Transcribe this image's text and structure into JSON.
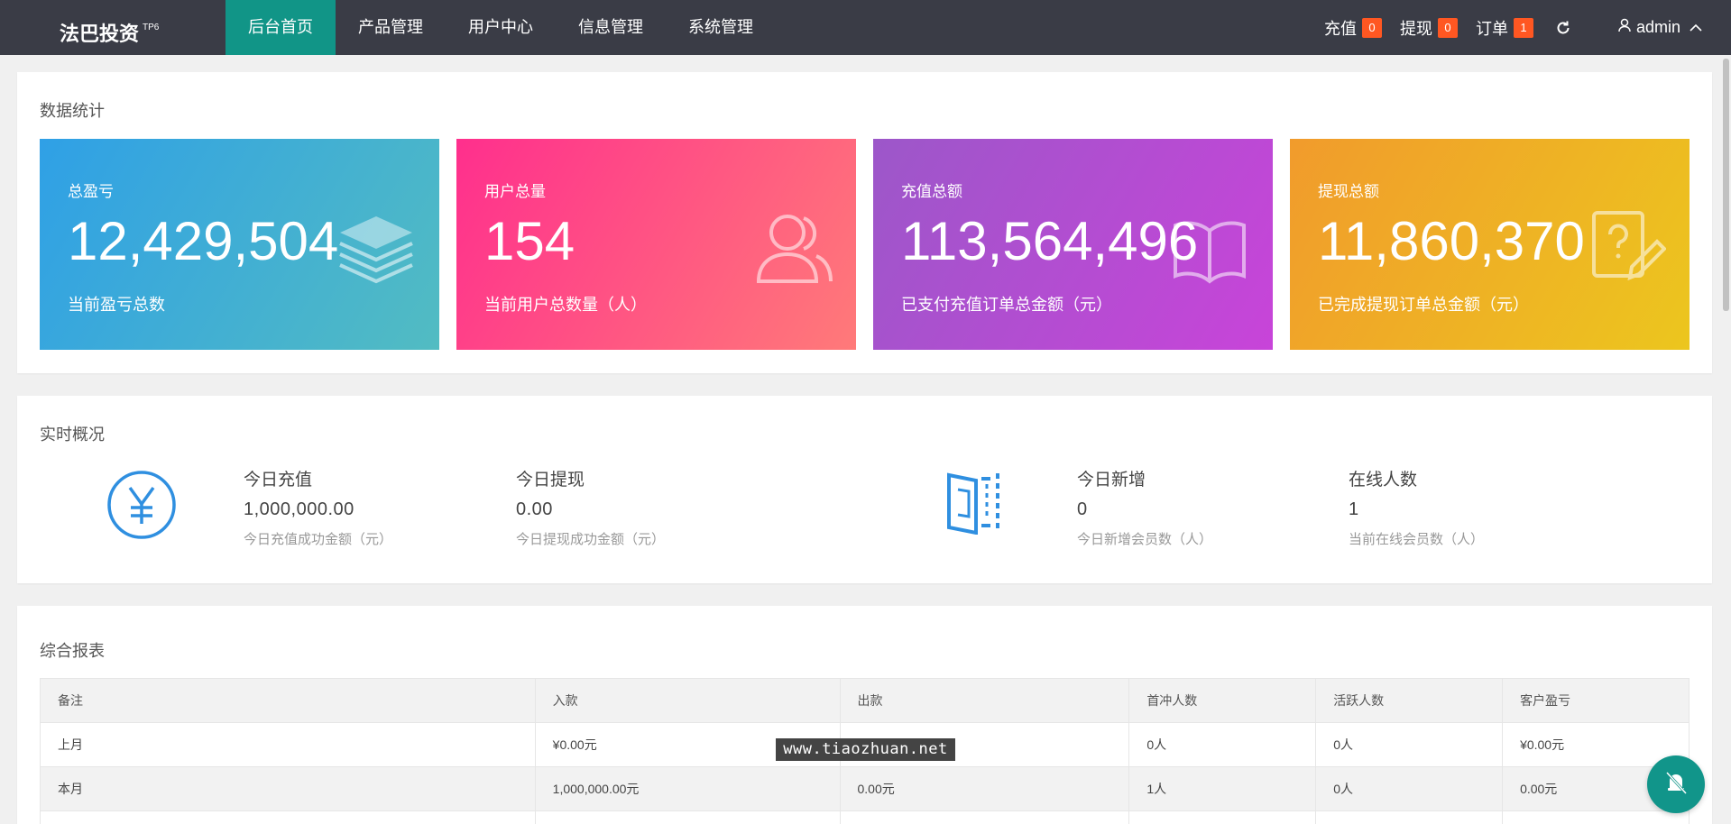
{
  "header": {
    "brand": "法巴投资",
    "brand_sup": "TP6",
    "nav": [
      "后台首页",
      "产品管理",
      "用户中心",
      "信息管理",
      "系统管理"
    ],
    "right": [
      {
        "label": "充值",
        "count": "0"
      },
      {
        "label": "提现",
        "count": "0"
      },
      {
        "label": "订单",
        "count": "1"
      }
    ],
    "user": "admin",
    "icons": {
      "refresh": "refresh-icon",
      "user": "user-icon",
      "chevron": "chevron-up-icon"
    }
  },
  "stats": {
    "title": "数据统计",
    "cards": [
      {
        "label": "总盈亏",
        "value": "12,429,504",
        "sub": "当前盈亏总数",
        "icon": "layers-icon"
      },
      {
        "label": "用户总量",
        "value": "154",
        "sub": "当前用户总数量（人）",
        "icon": "users-icon"
      },
      {
        "label": "充值总额",
        "value": "113,564,496",
        "sub": "已支付充值订单总金额（元）",
        "icon": "book-icon"
      },
      {
        "label": "提现总额",
        "value": "11,860,370",
        "sub": "已完成提现订单总金额（元）",
        "icon": "question-edit-icon"
      }
    ]
  },
  "overview": {
    "title": "实时概况",
    "items": [
      {
        "label": "今日充值",
        "value": "1,000,000.00",
        "sub": "今日充值成功金额（元）"
      },
      {
        "label": "今日提现",
        "value": "0.00",
        "sub": "今日提现成功金额（元）"
      },
      {
        "label": "今日新增",
        "value": "0",
        "sub": "今日新增会员数（人）"
      },
      {
        "label": "在线人数",
        "value": "1",
        "sub": "当前在线会员数（人）"
      }
    ],
    "icons": {
      "yuan": "yuan-icon",
      "door": "door-icon"
    }
  },
  "report": {
    "title": "综合报表",
    "columns": [
      "备注",
      "入款",
      "出款",
      "首冲人数",
      "活跃人数",
      "客户盈亏"
    ],
    "rows": [
      [
        "上月",
        "¥0.00元",
        "",
        "0人",
        "0人",
        "¥0.00元"
      ],
      [
        "本月",
        "1,000,000.00元",
        "0.00元",
        "1人",
        "0人",
        "0.00元"
      ],
      [
        "",
        "",
        "",
        "",
        "",
        ""
      ]
    ]
  },
  "watermark": "www.tiaozhuan.net",
  "colors": {
    "header_bg": "#3a3c46",
    "nav_active": "#119587",
    "badge": "#ff5722",
    "accent_blue": "#2f8fe0"
  }
}
